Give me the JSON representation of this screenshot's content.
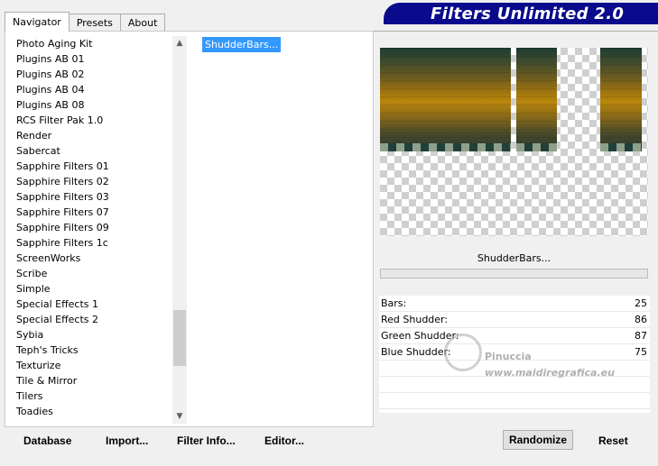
{
  "tabs": [
    {
      "label": "Navigator",
      "active": true
    },
    {
      "label": "Presets",
      "active": false
    },
    {
      "label": "About",
      "active": false
    }
  ],
  "banner": {
    "title": "Filters Unlimited 2.0",
    "color": "#0a0a8c"
  },
  "categories": [
    "Photo Aging Kit",
    "Plugins AB 01",
    "Plugins AB 02",
    "Plugins AB 04",
    "Plugins AB 08",
    "RCS Filter Pak 1.0",
    "Render",
    "Sabercat",
    "Sapphire Filters 01",
    "Sapphire Filters 02",
    "Sapphire Filters 03",
    "Sapphire Filters 07",
    "Sapphire Filters 09",
    "Sapphire Filters 1c",
    "ScreenWorks",
    "Scribe",
    "Simple",
    "Special Effects 1",
    "Special Effects 2",
    "Sybia",
    "Teph's Tricks",
    "Texturize",
    "Tile & Mirror",
    "Tilers",
    "Toadies"
  ],
  "filters": [
    {
      "label": "ShudderBars...",
      "selected": true
    }
  ],
  "selected_filter_name": "ShudderBars...",
  "parameters": [
    {
      "label": "Bars:",
      "value": "25"
    },
    {
      "label": "Red Shudder:",
      "value": "86"
    },
    {
      "label": "Green Shudder:",
      "value": "87"
    },
    {
      "label": "Blue Shudder:",
      "value": "75"
    }
  ],
  "watermark": {
    "line1": "Pinuccia",
    "line2": "www.maidiregrafica.eu"
  },
  "buttons": {
    "database": "Database",
    "import": "Import...",
    "filter_info": "Filter Info...",
    "editor": "Editor...",
    "randomize": "Randomize",
    "reset": "Reset"
  },
  "selection_color": "#3399ff"
}
